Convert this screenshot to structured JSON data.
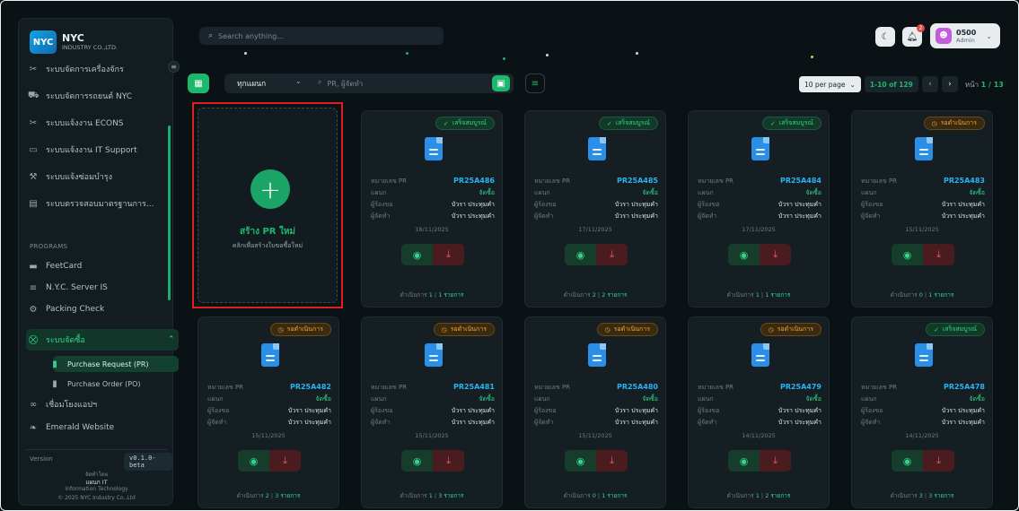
{
  "brand": {
    "logo": "NYC",
    "name": "NYC",
    "sub": "INDUSTRY CO.,LTD."
  },
  "sidebar": {
    "items": [
      {
        "label": "ระบบจัดการเครื่องจักร",
        "icon": "tools-icon"
      },
      {
        "label": "ระบบจัดการรถยนต์ NYC",
        "icon": "car-icon"
      },
      {
        "label": "ระบบแจ้งงาน ECONS",
        "icon": "tools-icon"
      },
      {
        "label": "ระบบแจ้งงาน IT Support",
        "icon": "monitor-icon"
      },
      {
        "label": "ระบบแจ้งซ่อมบำรุง",
        "icon": "wrench-icon"
      },
      {
        "label": "ระบบตรวจสอบมาตรฐานการ...",
        "icon": "clipboard-icon"
      }
    ],
    "section": "PROGRAMS",
    "programs": [
      {
        "label": "FeetCard",
        "icon": "card-icon"
      },
      {
        "label": "N.Y.C. Server IS",
        "icon": "server-icon"
      },
      {
        "label": "Packing Check",
        "icon": "package-icon"
      }
    ],
    "group": {
      "label": "ระบบจัดซื้อ",
      "sub1": "Purchase Request (PR)",
      "sub2": "Purchase Order (PO)"
    },
    "more": [
      {
        "label": "เชื่อมโยงแอปฯ",
        "icon": "link-icon"
      },
      {
        "label": "Emerald Website",
        "icon": "leaf-icon"
      }
    ],
    "version_label": "Version",
    "version": "v0.1.0-beta",
    "dev_by": "จัดทำโดย",
    "dept": "แผนก IT",
    "dept_full": "Information Technology",
    "copyright": "© 2025 NYC Industry Co.,Ltd"
  },
  "topbar": {
    "search_placeholder": "Search anything...",
    "notif_count": "2",
    "user_name": "0500",
    "user_role": "Admin"
  },
  "filter": {
    "dept": "ทุกแผนก",
    "query_placeholder": "PR, ผู้จัดทำ",
    "per_page": "10 per page",
    "range": "1-10 of 129",
    "page_label": "หน้า",
    "page": "1 / 13"
  },
  "create": {
    "title": "สร้าง PR ใหม่",
    "sub": "คลิกเพื่อสร้างใบขอซื้อใหม่"
  },
  "labels": {
    "pr_no": "หมายเลข PR",
    "dept": "แผนก",
    "requester": "ผู้ร้องขอ",
    "maker": "ผู้จัดทำ",
    "items_prefix": "ดำเนินการ",
    "items_suffix": "รายการ"
  },
  "colors": {
    "accent": "#1db86e",
    "done": "#31d68a",
    "wait": "#f1a53a",
    "link": "#2bb3f0"
  },
  "cards": [
    {
      "status": "เสร็จสมบูรณ์",
      "type": "done",
      "id": "PR25A486",
      "dept": "จัดซื้อ",
      "req": "บัวรา ประทุมคำ",
      "maker": "บัวรา ประทุมคำ",
      "date": "18/11/2025",
      "done": "1",
      "total": "1 รายการ"
    },
    {
      "status": "เสร็จสมบูรณ์",
      "type": "done",
      "id": "PR25A485",
      "dept": "จัดซื้อ",
      "req": "บัวรา ประทุมคำ",
      "maker": "บัวรา ประทุมคำ",
      "date": "17/11/2025",
      "done": "2",
      "total": "2 รายการ"
    },
    {
      "status": "เสร็จสมบูรณ์",
      "type": "done",
      "id": "PR25A484",
      "dept": "จัดซื้อ",
      "req": "บัวรา ประทุมคำ",
      "maker": "บัวรา ประทุมคำ",
      "date": "17/11/2025",
      "done": "1",
      "total": "1 รายการ"
    },
    {
      "status": "รอดำเนินการ",
      "type": "wait",
      "id": "PR25A483",
      "dept": "จัดซื้อ",
      "req": "บัวรา ประทุมคำ",
      "maker": "บัวรา ประทุมคำ",
      "date": "15/11/2025",
      "done": "0",
      "total": "1 รายการ"
    },
    {
      "status": "รอดำเนินการ",
      "type": "wait",
      "id": "PR25A482",
      "dept": "จัดซื้อ",
      "req": "บัวรา ประทุมคำ",
      "maker": "บัวรา ประทุมคำ",
      "date": "15/11/2025",
      "done": "2",
      "total": "3 รายการ"
    },
    {
      "status": "รอดำเนินการ",
      "type": "wait",
      "id": "PR25A481",
      "dept": "จัดซื้อ",
      "req": "บัวรา ประทุมคำ",
      "maker": "บัวรา ประทุมคำ",
      "date": "15/11/2025",
      "done": "1",
      "total": "3 รายการ"
    },
    {
      "status": "รอดำเนินการ",
      "type": "wait",
      "id": "PR25A480",
      "dept": "จัดซื้อ",
      "req": "บัวรา ประทุมคำ",
      "maker": "บัวรา ประทุมคำ",
      "date": "15/11/2025",
      "done": "0",
      "total": "1 รายการ"
    },
    {
      "status": "รอดำเนินการ",
      "type": "wait",
      "id": "PR25A479",
      "dept": "จัดซื้อ",
      "req": "บัวรา ประทุมคำ",
      "maker": "บัวรา ประทุมคำ",
      "date": "14/11/2025",
      "done": "1",
      "total": "2 รายการ"
    },
    {
      "status": "เสร็จสมบูรณ์",
      "type": "done",
      "id": "PR25A478",
      "dept": "จัดซื้อ",
      "req": "บัวรา ประทุมคำ",
      "maker": "บัวรา ประทุมคำ",
      "date": "14/11/2025",
      "done": "3",
      "total": "3 รายการ"
    }
  ]
}
